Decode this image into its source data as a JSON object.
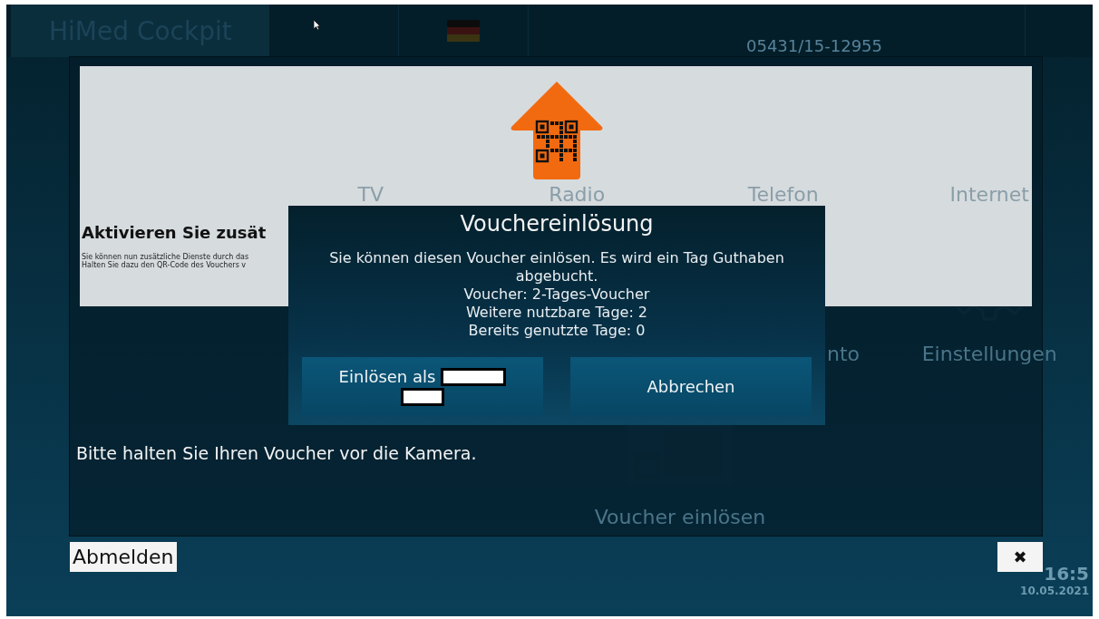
{
  "topbar": {
    "logo": "HiMed Cockpit",
    "phone": "05431/15-12955"
  },
  "tile_rows": [
    {
      "tiles": [
        {
          "label": "TV",
          "kind": "tv"
        },
        {
          "label": "Radio",
          "kind": "radio"
        },
        {
          "label": "Telefon",
          "kind": "phone"
        },
        {
          "label": "Internet",
          "kind": "globe"
        }
      ]
    },
    {
      "tiles": [
        {
          "label": "nto",
          "kind": "none"
        },
        {
          "label": "Einstellungen",
          "kind": "gear"
        }
      ]
    },
    {
      "tiles": [
        {
          "label": "Voucher einlösen",
          "kind": "qr"
        }
      ]
    }
  ],
  "status_bar": {
    "clock": "16:5",
    "date": "10.05.2021"
  },
  "overlay": {
    "heading": "Aktivieren Sie zusät",
    "text_lines": [
      "Sie können nun zusätzliche Dienste durch das",
      "Halten Sie dazu den QR-Code des Vouchers v"
    ],
    "instruction": "Bitte halten Sie Ihren Voucher vor die Kamera.",
    "logout_button": "Abmelden",
    "close_button": "✖"
  },
  "dialog": {
    "title": "Vouchereinlösung",
    "message_lines": [
      "Sie können diesen Voucher einlösen. Es wird ein Tag Guthaben abgebucht.",
      "Voucher: 2-Tages-Voucher",
      "Weitere nutzbare Tage: 2",
      "Bereits genutzte Tage: 0"
    ],
    "buttons": [
      {
        "label": "Einlösen als",
        "kind": "redeem"
      },
      {
        "label": "Abbrechen",
        "kind": "cancel"
      }
    ]
  }
}
